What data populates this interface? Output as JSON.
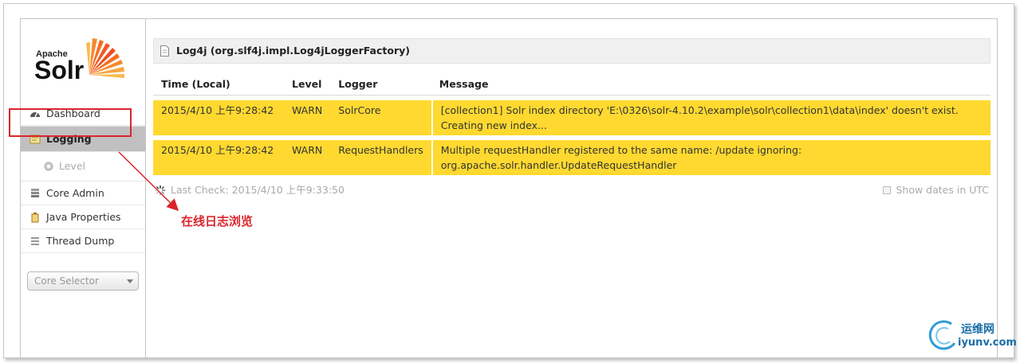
{
  "logo": {
    "apache": "Apache",
    "solr": "Solr"
  },
  "sidebar": {
    "items": [
      {
        "label": "Dashboard",
        "icon": "dashboard-icon"
      },
      {
        "label": "Logging",
        "icon": "logging-icon",
        "active": true
      },
      {
        "label": "Level",
        "icon": "gear-icon",
        "sub": true
      },
      {
        "label": "Core Admin",
        "icon": "core-admin-icon"
      },
      {
        "label": "Java Properties",
        "icon": "java-icon"
      },
      {
        "label": "Thread Dump",
        "icon": "thread-dump-icon"
      }
    ],
    "core_selector": {
      "placeholder": "Core Selector"
    }
  },
  "panel": {
    "title": "Log4j (org.slf4j.impl.Log4jLoggerFactory)"
  },
  "table": {
    "headers": {
      "time": "Time (Local)",
      "level": "Level",
      "logger": "Logger",
      "message": "Message"
    },
    "rows": [
      {
        "time": "2015/4/10 上午9:28:42",
        "level": "WARN",
        "logger": "SolrCore",
        "message": "[collection1] Solr index directory 'E:\\0326\\solr-4.10.2\\example\\solr\\collection1\\data\\index' doesn't exist. Creating new index..."
      },
      {
        "time": "2015/4/10 上午9:28:42",
        "level": "WARN",
        "logger": "RequestHandlers",
        "message": "Multiple requestHandler registered to the same name: /update ignoring: org.apache.solr.handler.UpdateRequestHandler"
      }
    ]
  },
  "status": {
    "last_check": "Last Check: 2015/4/10 上午9:33:50",
    "utc_label": "Show dates in UTC"
  },
  "annotation": {
    "text": "在线日志浏览"
  },
  "watermark": {
    "cn": "运维网",
    "url": "iyunv.com"
  },
  "colors": {
    "warn_row": "#ffd930",
    "annotation": "#d9262c",
    "active_nav": "#c0c0c0"
  }
}
